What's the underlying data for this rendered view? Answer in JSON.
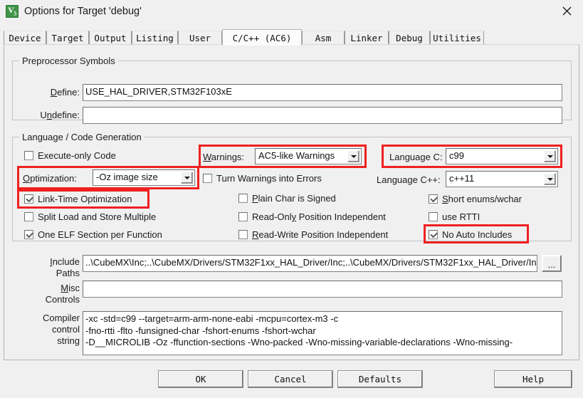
{
  "window": {
    "title": "Options for Target 'debug'",
    "app_icon_text": "V5",
    "close_label": "×"
  },
  "tabs": [
    {
      "label": "Device",
      "active": false
    },
    {
      "label": "Target",
      "active": false
    },
    {
      "label": "Output",
      "active": false
    },
    {
      "label": "Listing",
      "active": false
    },
    {
      "label": "User",
      "active": false
    },
    {
      "label": "C/C++ (AC6)",
      "active": true
    },
    {
      "label": "Asm",
      "active": false
    },
    {
      "label": "Linker",
      "active": false
    },
    {
      "label": "Debug",
      "active": false
    },
    {
      "label": "Utilities",
      "active": false
    }
  ],
  "preprocessor": {
    "legend": "Preprocessor Symbols",
    "define_label": "Define:",
    "define_value": "USE_HAL_DRIVER,STM32F103xE",
    "undefine_label": "Undefine:",
    "undefine_value": ""
  },
  "language": {
    "legend": "Language / Code Generation",
    "execute_only_code": "Execute-only Code",
    "optimization_label": "Optimization:",
    "optimization_value": "-Oz image size",
    "link_time_optimization": "Link-Time Optimization",
    "split_load_store": "Split Load and Store Multiple",
    "one_elf_section": "One ELF Section per Function",
    "warnings_label": "Warnings:",
    "warnings_value": "AC5-like Warnings",
    "turn_warnings_into_errors": "Turn Warnings into Errors",
    "plain_char_signed": "Plain Char is Signed",
    "read_only_position_independent": "Read-Only Position Independent",
    "read_write_position_independent": "Read-Write Position Independent",
    "language_c_label": "Language C:",
    "language_c_value": "c99",
    "language_cpp_label": "Language C++:",
    "language_cpp_value": "c++11",
    "short_enums_wchar": "Short enums/wchar",
    "use_rtti": "use RTTI",
    "no_auto_includes": "No Auto Includes"
  },
  "paths": {
    "include_label_line1": "Include",
    "include_label_line2": "Paths",
    "include_value": "..\\CubeMX\\Inc;..\\CubeMX/Drivers/STM32F1xx_HAL_Driver/Inc;..\\CubeMX/Drivers/STM32F1xx_HAL_Driver/In",
    "browse_label": "...",
    "misc_label_line1": "Misc",
    "misc_label_line2": "Controls",
    "misc_value": ""
  },
  "compiler": {
    "label_line1": "Compiler",
    "label_line2": "control",
    "label_line3": "string",
    "value": "-xc -std=c99 --target=arm-arm-none-eabi -mcpu=cortex-m3 -c\n-fno-rtti -flto -funsigned-char -fshort-enums -fshort-wchar\n-D__MICROLIB -Oz -ffunction-sections -Wno-packed -Wno-missing-variable-declarations -Wno-missing-"
  },
  "buttons": {
    "ok": "OK",
    "cancel": "Cancel",
    "defaults": "Defaults",
    "help": "Help"
  },
  "colors": {
    "highlight": "#ef2020",
    "dialog_bg": "#f0f0f0",
    "icon_green": "#3f9648"
  }
}
